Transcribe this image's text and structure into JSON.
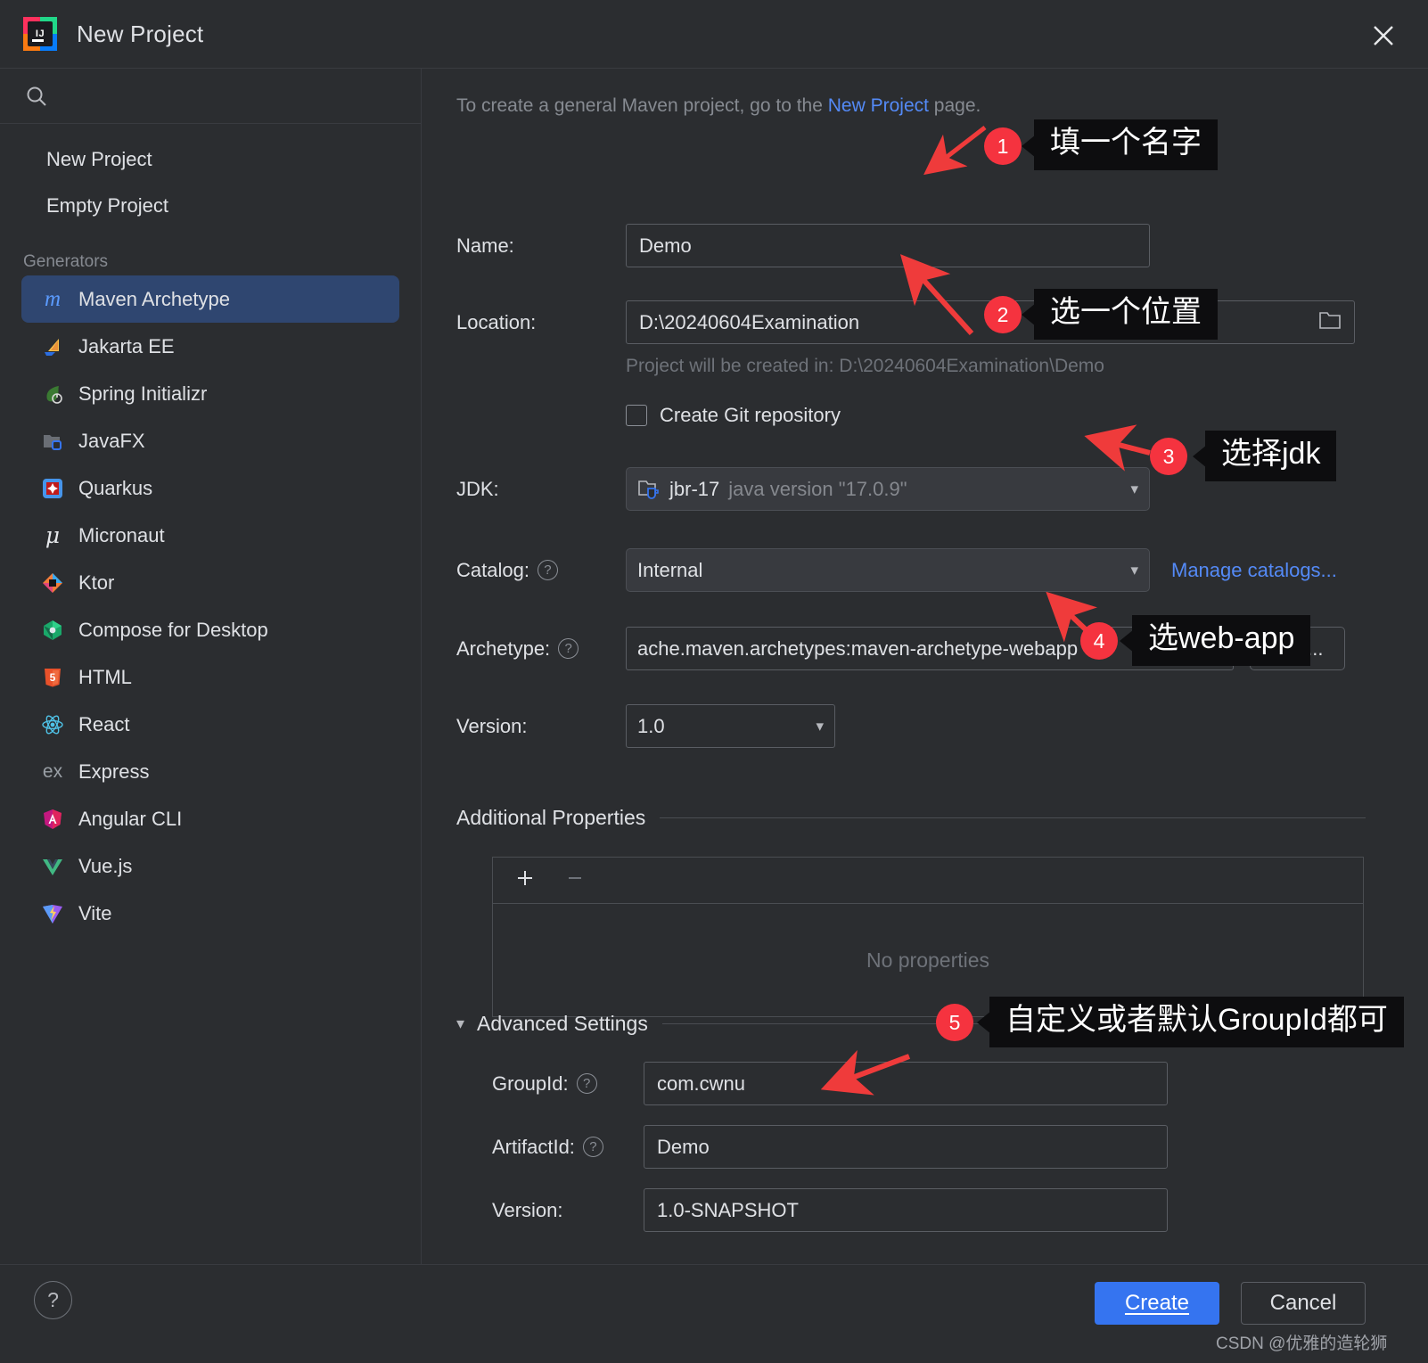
{
  "window": {
    "title": "New Project",
    "logo_text": "IJ",
    "close_icon": "close-icon"
  },
  "sidebar": {
    "search_placeholder": "",
    "nav": [
      {
        "label": "New Project"
      },
      {
        "label": "Empty Project"
      }
    ],
    "section_label": "Generators",
    "generators": [
      {
        "label": "Maven Archetype",
        "icon": "maven-icon",
        "selected": true
      },
      {
        "label": "Jakarta EE",
        "icon": "jakarta-ee-icon",
        "selected": false
      },
      {
        "label": "Spring Initializr",
        "icon": "spring-icon",
        "selected": false
      },
      {
        "label": "JavaFX",
        "icon": "javafx-icon",
        "selected": false
      },
      {
        "label": "Quarkus",
        "icon": "quarkus-icon",
        "selected": false
      },
      {
        "label": "Micronaut",
        "icon": "micronaut-icon",
        "selected": false
      },
      {
        "label": "Ktor",
        "icon": "ktor-icon",
        "selected": false
      },
      {
        "label": "Compose for Desktop",
        "icon": "compose-icon",
        "selected": false
      },
      {
        "label": "HTML",
        "icon": "html5-icon",
        "selected": false
      },
      {
        "label": "React",
        "icon": "react-icon",
        "selected": false
      },
      {
        "label": "Express",
        "icon": "express-icon",
        "selected": false
      },
      {
        "label": "Angular CLI",
        "icon": "angular-icon",
        "selected": false
      },
      {
        "label": "Vue.js",
        "icon": "vue-icon",
        "selected": false
      },
      {
        "label": "Vite",
        "icon": "vite-icon",
        "selected": false
      }
    ]
  },
  "form": {
    "hint_prefix": "To create a general Maven project, go to the ",
    "hint_link": "New Project",
    "hint_suffix": " page.",
    "name_label": "Name:",
    "name_value": "Demo",
    "location_label": "Location:",
    "location_value": "D:\\20240604Examination",
    "location_browse_icon": "folder-icon",
    "project_path_note": "Project will be created in: D:\\20240604Examination\\Demo",
    "git_checkbox_label": "Create Git repository",
    "git_checked": false,
    "jdk_label": "JDK:",
    "jdk_value": "jbr-17",
    "jdk_value_detail": "java version \"17.0.9\"",
    "jdk_icon": "jdk-folder-icon",
    "catalog_label": "Catalog:",
    "catalog_value": "Internal",
    "manage_catalogs_link": "Manage catalogs...",
    "archetype_label": "Archetype:",
    "archetype_value": "ache.maven.archetypes:maven-archetype-webapp",
    "archetype_add_button": "Add...",
    "version_label": "Version:",
    "version_value": "1.0",
    "additional_properties_title": "Additional Properties",
    "props_add_icon": "plus-icon",
    "props_remove_icon": "minus-icon",
    "props_empty_text": "No properties",
    "advanced_settings_title": "Advanced Settings",
    "advanced_caret_icon": "chevron-down-icon",
    "groupid_label": "GroupId:",
    "groupid_value": "com.cwnu",
    "artifactid_label": "ArtifactId:",
    "artifactid_value": "Demo",
    "adv_version_label": "Version:",
    "adv_version_value": "1.0-SNAPSHOT"
  },
  "footer": {
    "help_icon": "question-mark-icon",
    "create_button": "Create",
    "cancel_button": "Cancel",
    "watermark": "CSDN @优雅的造轮狮"
  },
  "annotations": [
    {
      "number": "1",
      "text": "填一个名字"
    },
    {
      "number": "2",
      "text": "选一个位置"
    },
    {
      "number": "3",
      "text": "选择jdk"
    },
    {
      "number": "4",
      "text": "选web-app"
    },
    {
      "number": "5",
      "text": "自定义或者默认GroupId都可"
    }
  ],
  "colors": {
    "accent_blue": "#3574f0",
    "link_blue": "#548af7",
    "annotation_red": "#f5333f",
    "selection_blue": "#2f4670",
    "background": "#2b2d30"
  }
}
